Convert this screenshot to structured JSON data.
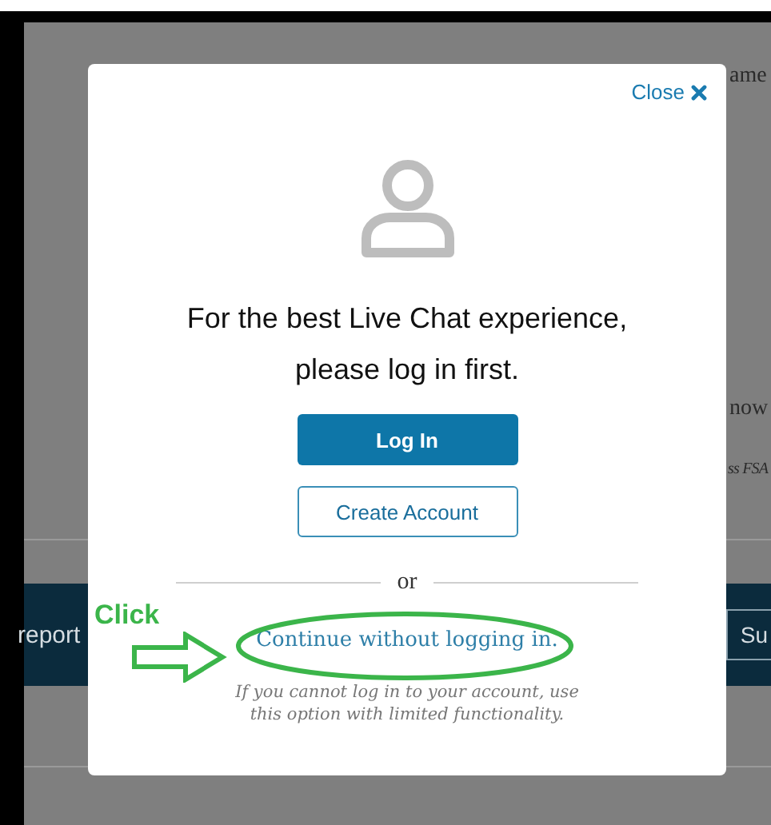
{
  "background_page": {
    "texts": [
      {
        "text": "ame",
        "italic": false
      },
      {
        "text": "now",
        "italic": false
      },
      {
        "text": "ss FSA",
        "italic": true
      }
    ],
    "banner": {
      "left_text": "report",
      "right_button": "Su"
    }
  },
  "modal": {
    "close": "Close",
    "heading": "For the best Live Chat experience, please log in first.",
    "buttons": [
      {
        "label": "Log In",
        "kind": "primary"
      },
      {
        "label": "Create Account",
        "kind": "secondary"
      }
    ],
    "separator": "or",
    "link": "Continue without logging in.",
    "note": "If you cannot log in to your account, use this option with limited functionality."
  },
  "annotation": {
    "label": "Click"
  }
}
